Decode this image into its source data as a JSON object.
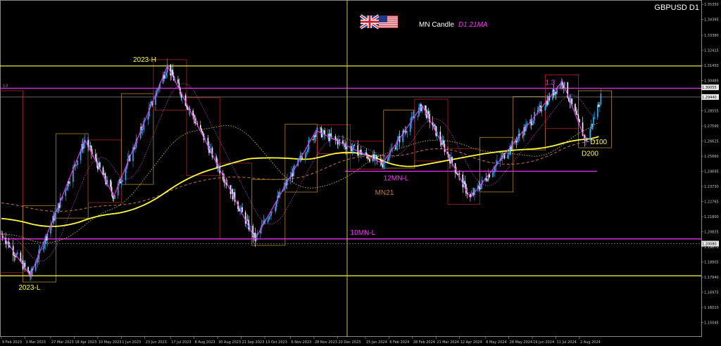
{
  "symbol_title": "GBPUSD D1",
  "header": {
    "caption": "MN Candle",
    "caption_ma": "D1 21MA",
    "flags": [
      "uk-flag-icon",
      "us-flag-icon"
    ]
  },
  "colors": {
    "background": "#000000",
    "yellow": "#ffff33",
    "magenta": "#ff33ff",
    "orange_ma": "#c87830",
    "candle_bull": "#2bb3ff",
    "candle_bear": "#ffffff",
    "month_bull": "#c89a28",
    "month_bear": "#c82828",
    "text": "#ffffff"
  },
  "chart_data": {
    "type": "candlestick",
    "symbol": "GBPUSD",
    "timeframe": "D1",
    "ylim": [
      1.1413,
      1.3563
    ],
    "y_ticks": [
      "1.35350",
      "1.34395",
      "1.33380",
      "1.32415",
      "1.31450",
      "1.30485",
      "1.29520",
      "1.28555",
      "1.27590",
      "1.26625",
      "1.25660",
      "1.24695",
      "1.23730",
      "1.22765",
      "1.21800",
      "1.20835",
      "1.19870",
      "1.18905",
      "1.17940",
      "1.16975",
      "1.16010",
      "1.15045"
    ],
    "x_ticks": [
      "9 Feb 2023",
      "3 Mar 2023",
      "27 Mar 2023",
      "18 Apr 2023",
      "10 May 2023",
      "1 Jun 2023",
      "23 Jun 2023",
      "17 Jul 2023",
      "8 Aug 2023",
      "30 Aug 2023",
      "21 Sep 2023",
      "13 Oct 2023",
      "6 Nov 2023",
      "28 Nov 2023",
      "20 Dec 2023",
      "15 Jan 2024",
      "6 Feb 2024",
      "28 Feb 2024",
      "21 Mar 2024",
      "12 Apr 2024",
      "6 May 2024",
      "28 May 2024",
      "19 Jun 2024",
      "11 Jul 2024",
      "2 Aug 2024"
    ],
    "price_boxes": [
      "1.30055",
      "1.29440",
      "1.20080"
    ],
    "levels": [
      {
        "label": "2023-H",
        "price": 1.3142,
        "color": "#ffff33"
      },
      {
        "label": "1.3",
        "price": 1.3,
        "color": "#ff33ff"
      },
      {
        "label": "12MN-L",
        "price": 1.247,
        "color": "#ff33ff"
      },
      {
        "label": "10MN-L",
        "price": 1.2038,
        "color": "#ff33ff"
      },
      {
        "label": "2023-L",
        "price": 1.1803,
        "color": "#ffff33"
      }
    ],
    "grey_levels": [
      1.2944,
      1.2008
    ],
    "close_price": 1.2944,
    "annotations": [
      "2023-H",
      "2023-L",
      "1.3",
      "12MN-L",
      "10MN-L",
      "MN21",
      "D100",
      "D200"
    ],
    "swing_points": [
      {
        "date": "2023-02-09",
        "price": 1.207
      },
      {
        "date": "2023-03-08",
        "price": 1.1803
      },
      {
        "date": "2023-04-28",
        "price": 1.267
      },
      {
        "date": "2023-05-25",
        "price": 1.231
      },
      {
        "date": "2023-07-14",
        "price": 1.3142
      },
      {
        "date": "2023-10-04",
        "price": 1.2037
      },
      {
        "date": "2023-11-30",
        "price": 1.273
      },
      {
        "date": "2024-01-31",
        "price": 1.252
      },
      {
        "date": "2024-03-08",
        "price": 1.289
      },
      {
        "date": "2024-04-22",
        "price": 1.23
      },
      {
        "date": "2024-07-17",
        "price": 1.3045
      },
      {
        "date": "2024-08-08",
        "price": 1.266
      },
      {
        "date": "2024-08-22",
        "price": 1.2944
      }
    ],
    "series": [
      {
        "name": "D100",
        "type": "ma"
      },
      {
        "name": "D200",
        "type": "ma"
      },
      {
        "name": "MN21",
        "type": "ma"
      }
    ],
    "legend": "none",
    "grid": false
  }
}
